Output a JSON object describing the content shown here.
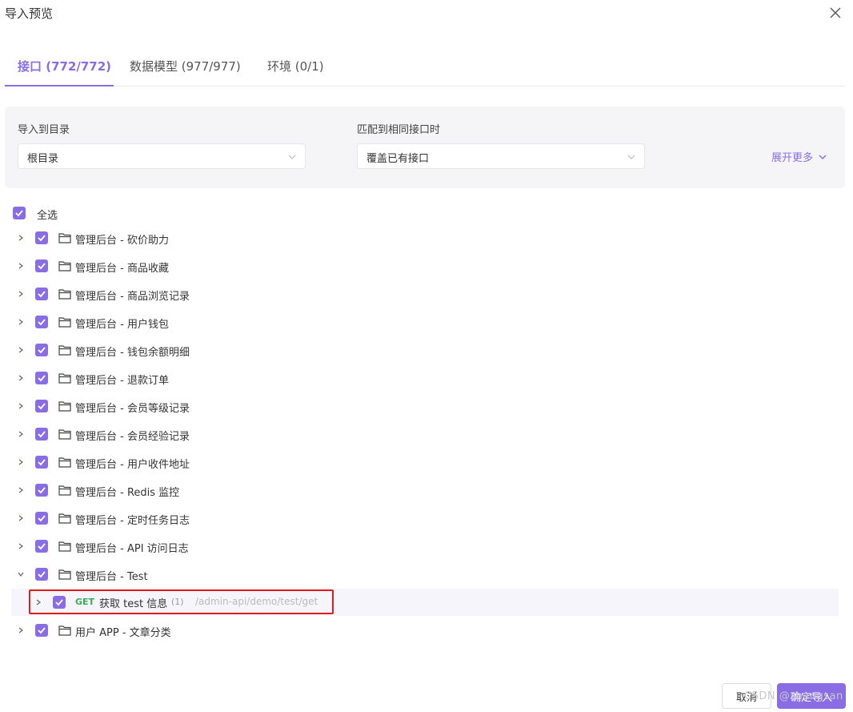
{
  "dialog": {
    "title": "导入预览"
  },
  "tabs": [
    {
      "label": "接口 (772/772)",
      "active": true
    },
    {
      "label": "数据模型 (977/977)",
      "active": false
    },
    {
      "label": "环境 (0/1)",
      "active": false
    }
  ],
  "options": {
    "target_dir": {
      "label": "导入到目录",
      "value": "根目录"
    },
    "on_match": {
      "label": "匹配到相同接口时",
      "value": "覆盖已有接口"
    },
    "expand_more": "展开更多"
  },
  "tree": {
    "select_all": "全选",
    "folders": [
      "管理后台 - 砍价助力",
      "管理后台 - 商品收藏",
      "管理后台 - 商品浏览记录",
      "管理后台 - 用户钱包",
      "管理后台 - 钱包余额明细",
      "管理后台 - 退款订单",
      "管理后台 - 会员等级记录",
      "管理后台 - 会员经验记录",
      "管理后台 - 用户收件地址",
      "管理后台 - Redis 监控",
      "管理后台 - 定时任务日志",
      "管理后台 - API 访问日志",
      "管理后台 - Test"
    ],
    "api": {
      "method": "GET",
      "name": "获取 test 信息",
      "count": "(1)",
      "path": "/admin-api/demo/test/get"
    },
    "last_folder": "用户 APP - 文章分类"
  },
  "footer": {
    "cancel": "取消",
    "confirm": "确定导入",
    "watermark": "CSDN @zhangsan"
  },
  "colors": {
    "accent": "#8a6de4",
    "get": "#3eaa58",
    "highlight": "#e21b1b"
  }
}
